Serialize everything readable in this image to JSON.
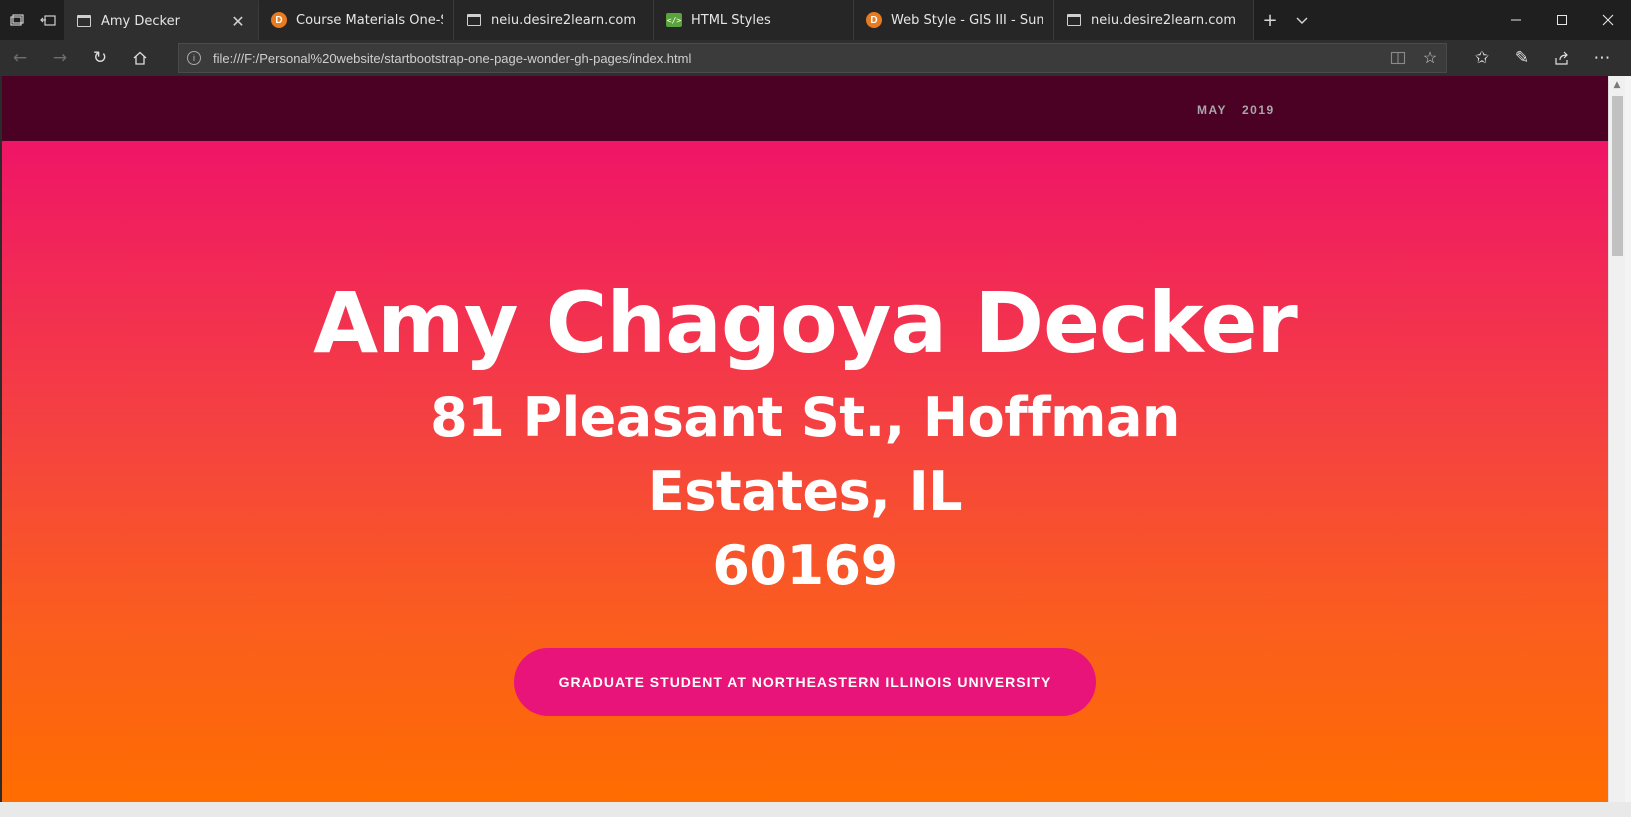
{
  "tabs": [
    {
      "title": "Amy Decker",
      "favicon": "page-icon",
      "active": true
    },
    {
      "title": "Course Materials One-Stop",
      "favicon": "d2l-icon",
      "active": false
    },
    {
      "title": "neiu.desire2learn.com",
      "favicon": "page-icon",
      "active": false
    },
    {
      "title": "HTML Styles",
      "favicon": "html-icon",
      "active": false
    },
    {
      "title": "Web Style - GIS III - Summe",
      "favicon": "d2l-icon",
      "active": false
    },
    {
      "title": "neiu.desire2learn.com",
      "favicon": "page-icon",
      "active": false
    }
  ],
  "address_bar": {
    "url": "file:///F:/Personal%20website/startbootstrap-one-page-wonder-gh-pages/index.html"
  },
  "site_nav": {
    "links": [
      "MAY",
      "2019"
    ]
  },
  "hero": {
    "name": "Amy Chagoya Decker",
    "address_line1": "81 Pleasant St., Hoffman Estates, IL",
    "address_line2": "60169",
    "button_label": "GRADUATE STUDENT AT NORTHEASTERN ILLINOIS UNIVERSITY"
  },
  "colors": {
    "nav_background": "#4a0124",
    "hero_gradient_top": "#ef1567",
    "hero_gradient_bottom": "#ff6d00",
    "button_background": "#e9147a"
  }
}
